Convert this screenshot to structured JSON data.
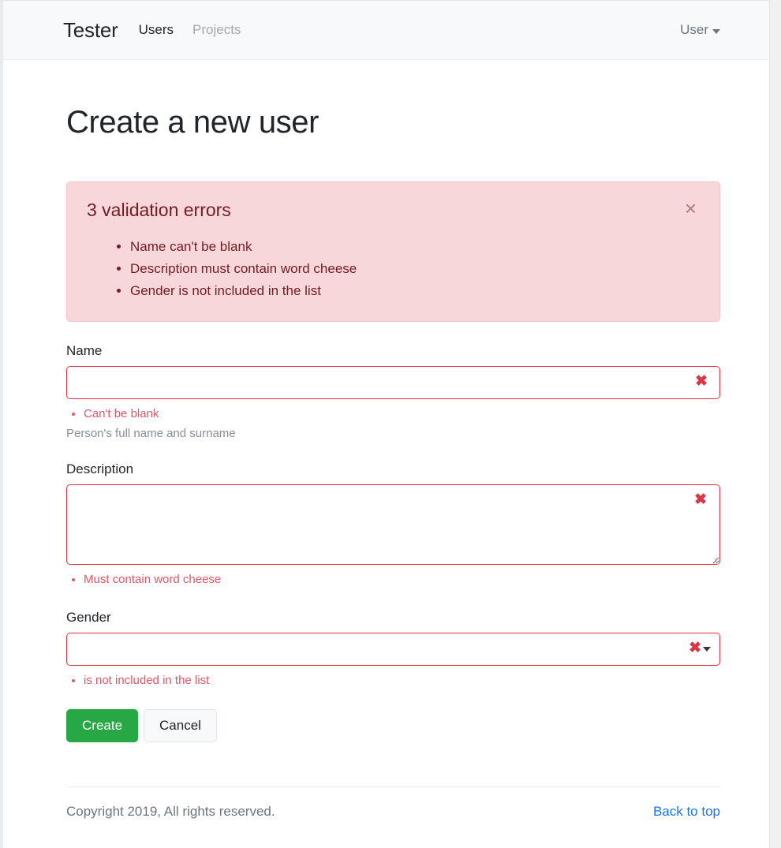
{
  "navbar": {
    "brand": "Tester",
    "links": [
      {
        "label": "Users",
        "state": "active"
      },
      {
        "label": "Projects",
        "state": "muted"
      }
    ],
    "user_menu": {
      "label": "User",
      "caret_icon": "caret-down-icon"
    }
  },
  "page": {
    "title": "Create a new user"
  },
  "alert": {
    "heading": "3 validation errors",
    "close_icon": "close-icon",
    "close_label": "×",
    "background_color": "#f8d7da",
    "text_color": "#721c24",
    "errors": [
      "Name can't be blank",
      "Description must contain word cheese",
      "Gender is not included in the list"
    ]
  },
  "form": {
    "name": {
      "label": "Name",
      "value": "",
      "placeholder": "",
      "invalid_icon": "invalid-x-icon",
      "invalid_mark": "✖",
      "errors": [
        "Can't be blank"
      ],
      "help": "Person's full name and surname"
    },
    "description": {
      "label": "Description",
      "value": "",
      "placeholder": "",
      "invalid_icon": "invalid-x-icon",
      "invalid_mark": "✖",
      "errors": [
        "Must contain word cheese"
      ],
      "resize_handle_icon": "resize-grip-icon"
    },
    "gender": {
      "label": "Gender",
      "value": "",
      "selected_option": "",
      "options": [
        ""
      ],
      "invalid_icon": "invalid-x-icon",
      "invalid_mark": "✖",
      "caret_icon": "caret-down-icon",
      "errors": [
        " is not included in the list"
      ]
    },
    "buttons": {
      "submit": "Create",
      "cancel": "Cancel",
      "submit_color": "#28a745"
    },
    "invalid_border_color": "#dc3545",
    "error_text_color": "#e0566a"
  },
  "footer": {
    "copyright": "Copyright 2019, All rights reserved.",
    "back_to_top": "Back to top",
    "link_color": "#1a73e8"
  }
}
